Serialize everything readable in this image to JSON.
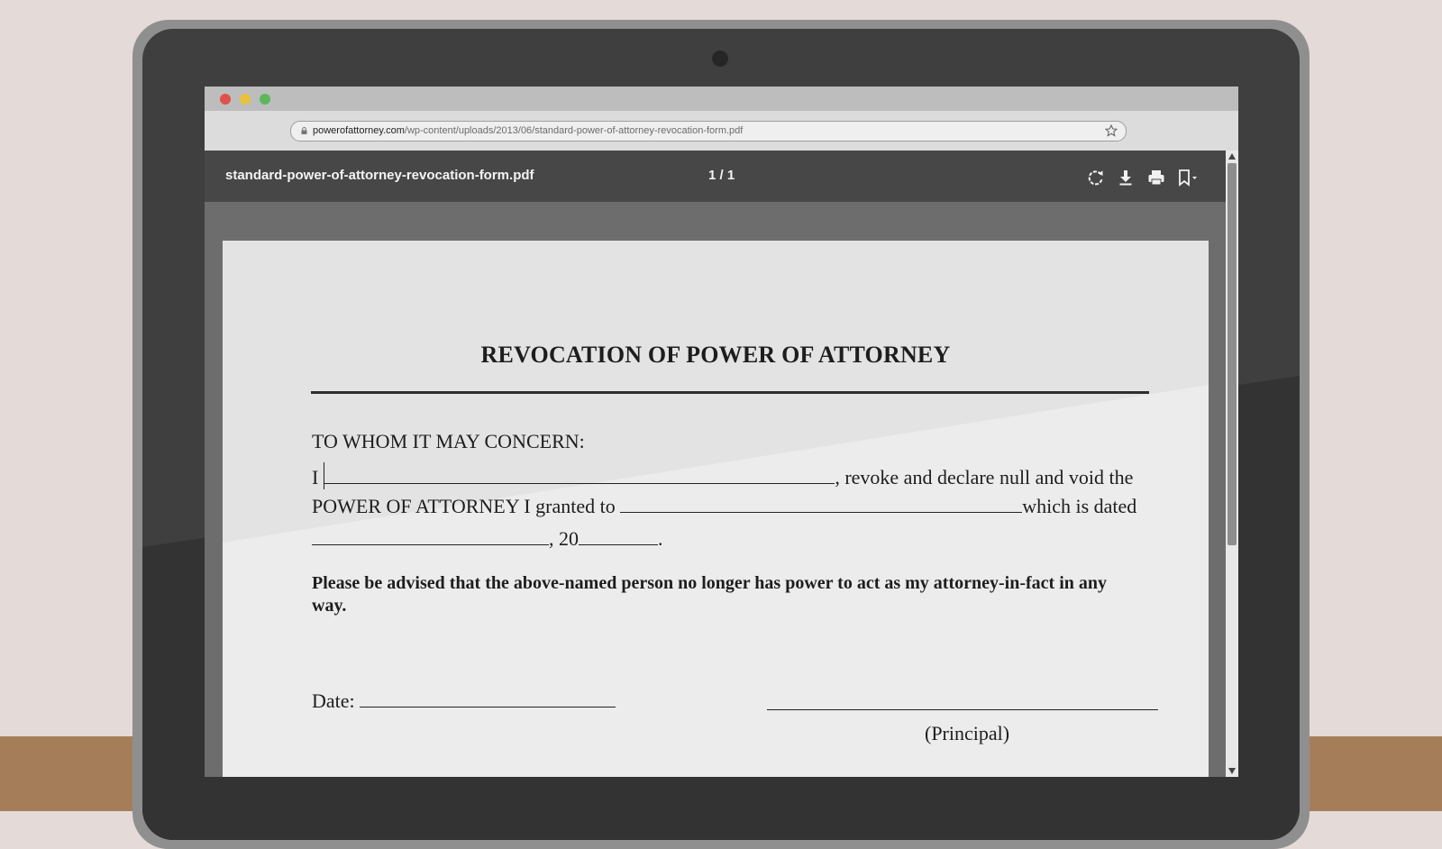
{
  "browser": {
    "url_domain": "powerofattorney.com",
    "url_path": "/wp-content/uploads/2013/06/standard-power-of-attorney-revocation-form.pdf"
  },
  "pdf_viewer": {
    "file_name": "standard-power-of-attorney-revocation-form.pdf",
    "page_counter": "1 / 1",
    "toolbar_icons": [
      "rotate-icon",
      "download-icon",
      "print-icon",
      "bookmark-icon"
    ]
  },
  "document": {
    "title": "REVOCATION OF POWER OF ATTORNEY",
    "salutation": "TO WHOM IT MAY CONCERN:",
    "line1_start": "I",
    "line1_end": ", revoke and declare null and void the",
    "line2_start": "POWER OF ATTORNEY I granted to",
    "line2_end": "which is dated",
    "line3_mid": ", 20",
    "line3_end": ".",
    "notice": "Please be advised that the above-named person no longer has power to act as my attorney-in-fact in any way.",
    "date_label": "Date:",
    "principal_label": "(Principal)"
  },
  "colors": {
    "wall": "#e4dad7",
    "desk": "#a57e59",
    "laptop_frame": "#3f3f3f",
    "viewer_toolbar": "#474747",
    "page": "#ececec"
  }
}
